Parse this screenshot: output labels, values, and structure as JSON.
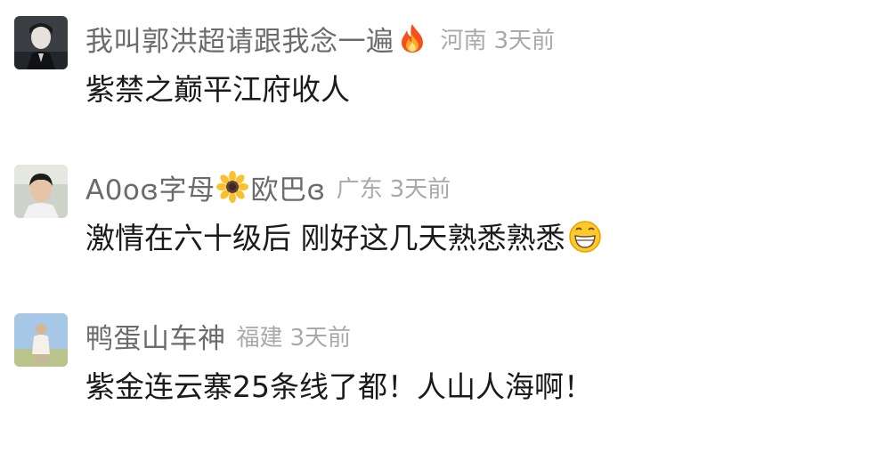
{
  "comments": [
    {
      "username": "我叫郭洪超请跟我念一遍",
      "username_emoji": "fire-icon",
      "location": "河南",
      "time": "3天前",
      "text": "紫禁之巅平江府收人"
    },
    {
      "username_part1": "A0oɞ字母",
      "username_emoji": "sunflower-icon",
      "username_part2": "欧巴ɞ",
      "location": "广东",
      "time": "3天前",
      "text": "激情在六十级后 刚好这几天熟悉熟悉",
      "text_emoji": "grinning-face-icon"
    },
    {
      "username": "鸭蛋山车神",
      "location": "福建",
      "time": "3天前",
      "text": "紫金连云寨25条线了都！人山人海啊！"
    }
  ],
  "colors": {
    "username": "#6b6b6b",
    "meta": "#a9a9a9",
    "text": "#1a1a1a"
  }
}
